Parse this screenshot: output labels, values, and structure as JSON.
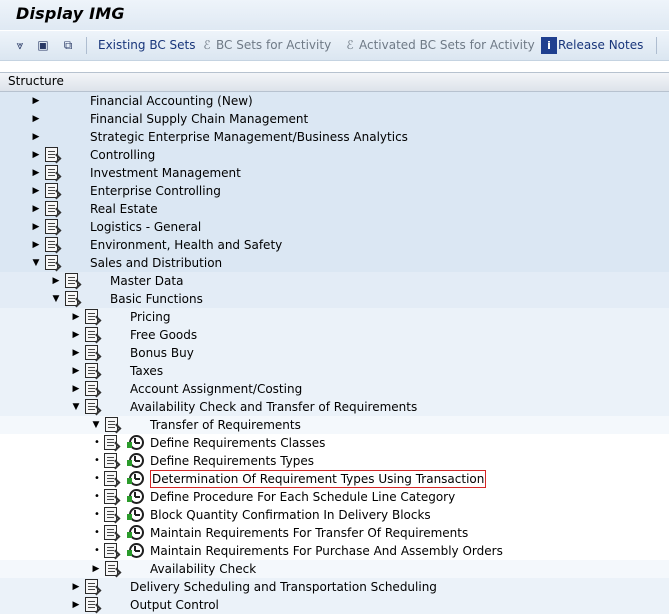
{
  "window": {
    "title": "Display IMG"
  },
  "toolbar": {
    "icons": [
      "filter-icon",
      "find-icon",
      "refresh-icon"
    ],
    "existing_bc_sets": "Existing BC Sets",
    "bc_sets_activity": "BC Sets for Activity",
    "activated_bc_sets": "Activated BC Sets for Activity",
    "release_notes": "Release Notes"
  },
  "structure": {
    "header": "Structure",
    "nodes": [
      {
        "label": "Financial Accounting (New)"
      },
      {
        "label": "Financial Supply Chain Management"
      },
      {
        "label": "Strategic Enterprise Management/Business Analytics"
      },
      {
        "label": "Controlling"
      },
      {
        "label": "Investment Management"
      },
      {
        "label": "Enterprise Controlling"
      },
      {
        "label": "Real Estate"
      },
      {
        "label": "Logistics - General"
      },
      {
        "label": "Environment, Health and Safety"
      },
      {
        "label": "Sales and Distribution"
      },
      {
        "label": "Master Data"
      },
      {
        "label": "Basic Functions"
      },
      {
        "label": "Pricing"
      },
      {
        "label": "Free Goods"
      },
      {
        "label": "Bonus Buy"
      },
      {
        "label": "Taxes"
      },
      {
        "label": "Account Assignment/Costing"
      },
      {
        "label": "Availability Check and Transfer of Requirements"
      },
      {
        "label": "Transfer of Requirements"
      },
      {
        "label": "Define Requirements Classes"
      },
      {
        "label": "Define Requirements Types"
      },
      {
        "label": "Determination Of Requirement Types Using Transaction"
      },
      {
        "label": "Define Procedure For Each Schedule Line Category"
      },
      {
        "label": "Block Quantity Confirmation In Delivery Blocks"
      },
      {
        "label": "Maintain Requirements For Transfer Of Requirements"
      },
      {
        "label": "Maintain Requirements For Purchase And Assembly Orders"
      },
      {
        "label": "Availability Check"
      },
      {
        "label": "Delivery Scheduling and Transportation Scheduling"
      },
      {
        "label": "Output Control"
      }
    ]
  }
}
